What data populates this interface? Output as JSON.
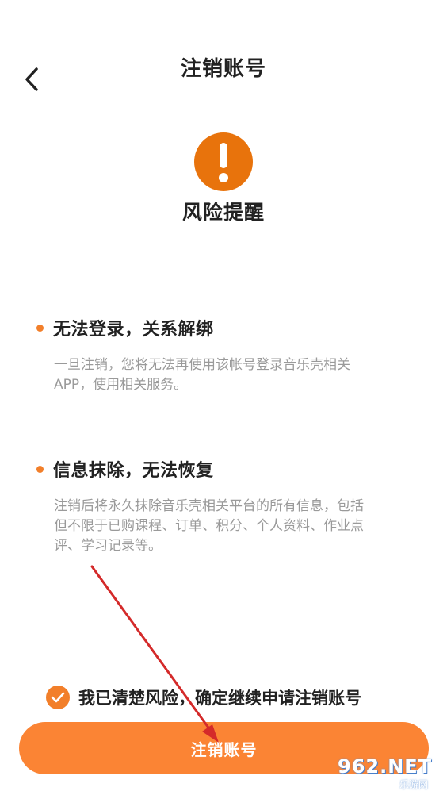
{
  "header": {
    "title": "注销账号"
  },
  "warning": {
    "title": "风险提醒",
    "icon": "exclamation-circle-icon",
    "color": "#e8730c"
  },
  "sections": [
    {
      "heading": "无法登录，关系解绑",
      "lines": [
        "一旦注销，您将无法再使用该帐号登录音乐壳相关",
        "APP，使用相关服务。"
      ]
    },
    {
      "heading": "信息抹除，无法恢复",
      "lines": [
        "注销后将永久抹除音乐壳相关平台的所有信息，包括",
        "但不限于已购课程、订单、积分、个人资料、作业点",
        "评、学习记录等。"
      ]
    }
  ],
  "agreement": {
    "text": "我已清楚风险，确定继续申请注销账号",
    "checked": true
  },
  "button": {
    "label": "注销账号"
  },
  "watermark": {
    "logo": "962.NET",
    "sub": "乐游网"
  },
  "colors": {
    "accent": "#fb8434",
    "bullet": "#f27f2a",
    "arrow": "#d42a2a"
  }
}
